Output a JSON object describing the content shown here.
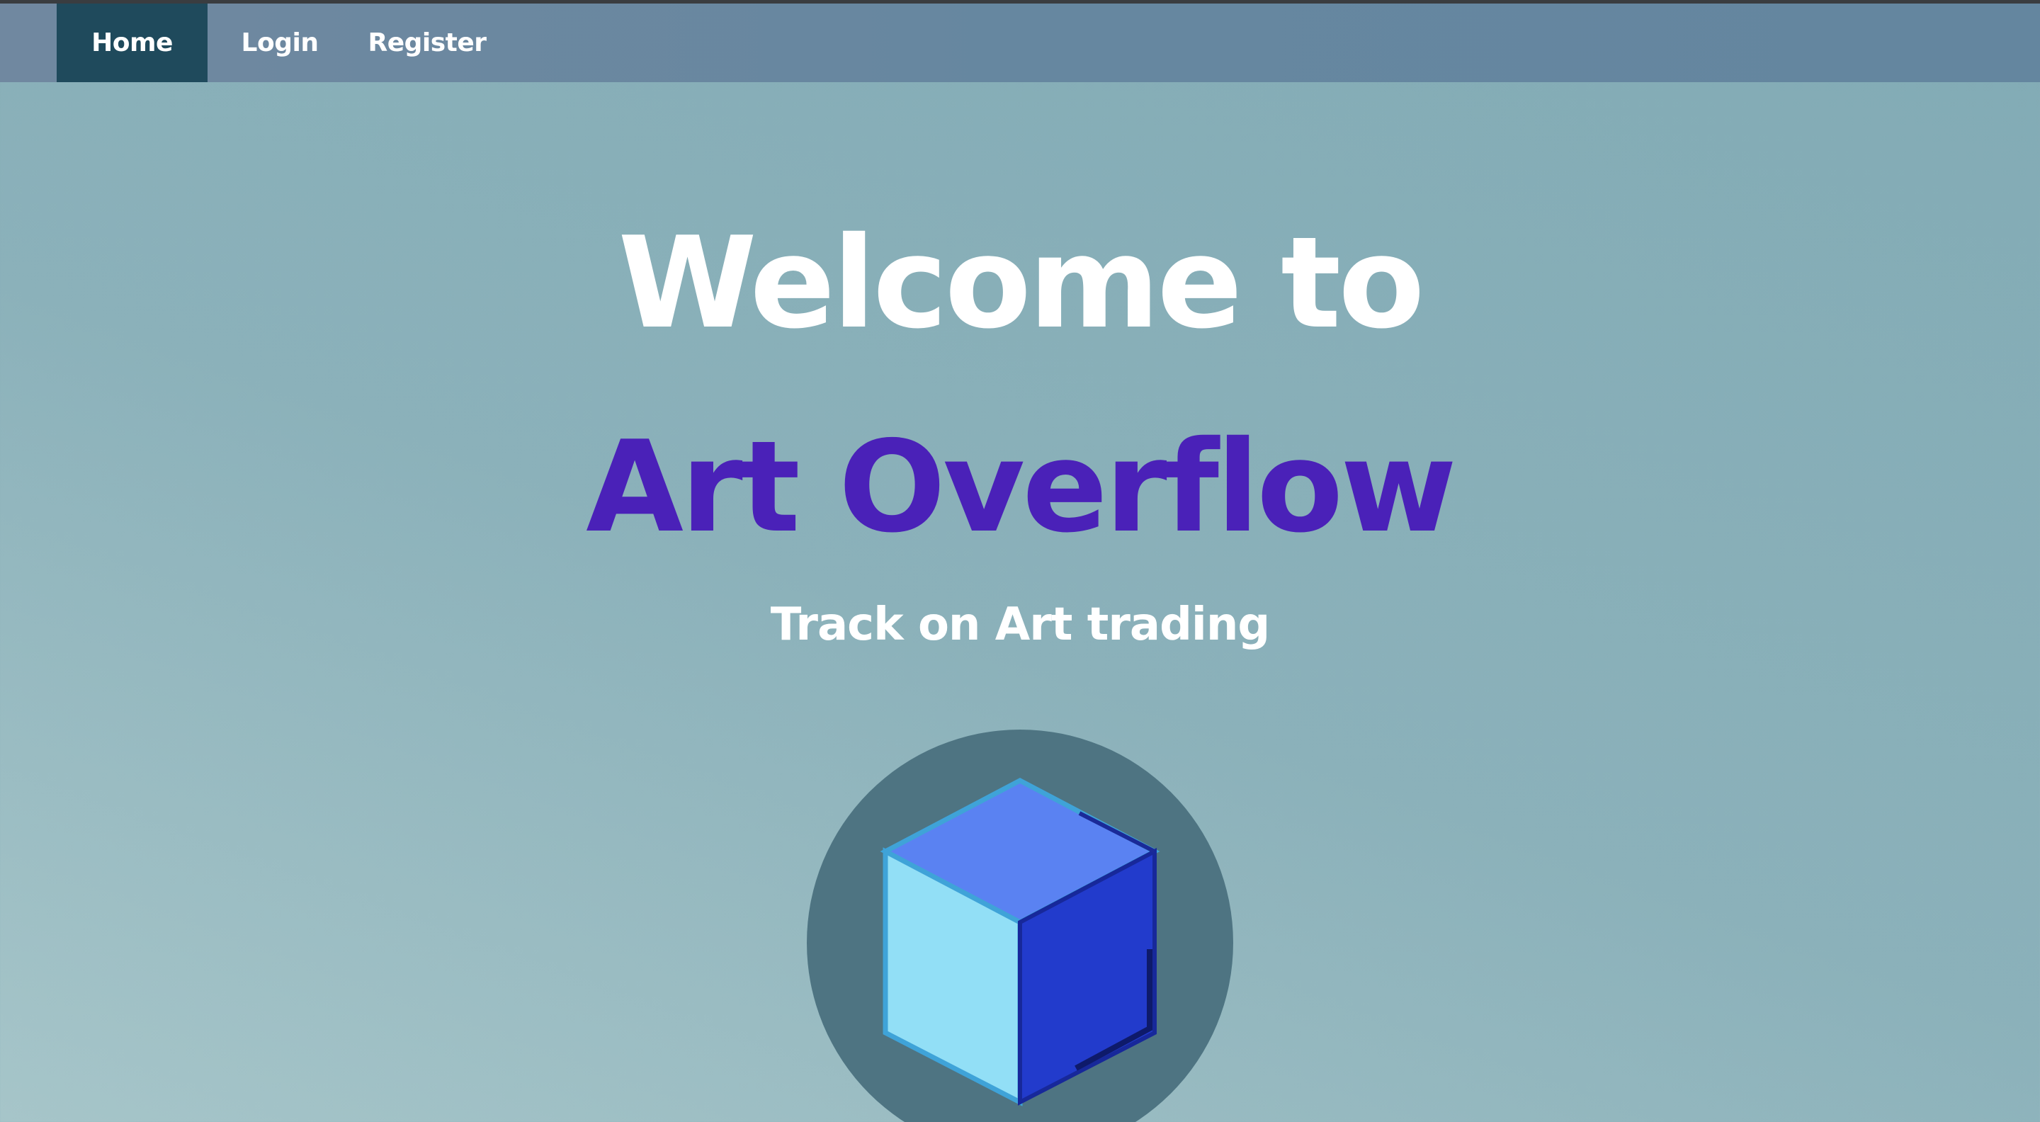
{
  "nav": {
    "items": [
      {
        "label": "Home",
        "active": true
      },
      {
        "label": "Login",
        "active": false
      },
      {
        "label": "Register",
        "active": false
      }
    ]
  },
  "hero": {
    "line1": "Welcome to",
    "line2": "Art Overflow",
    "tagline": "Track on Art trading"
  },
  "logo": {
    "icon": "cube-icon"
  },
  "colors": {
    "nav_active": "#1f4a5c",
    "brand_purple": "#4a21b8",
    "cube_top": "#5a82f2",
    "cube_left": "#92dff6",
    "cube_right": "#223bcc"
  }
}
